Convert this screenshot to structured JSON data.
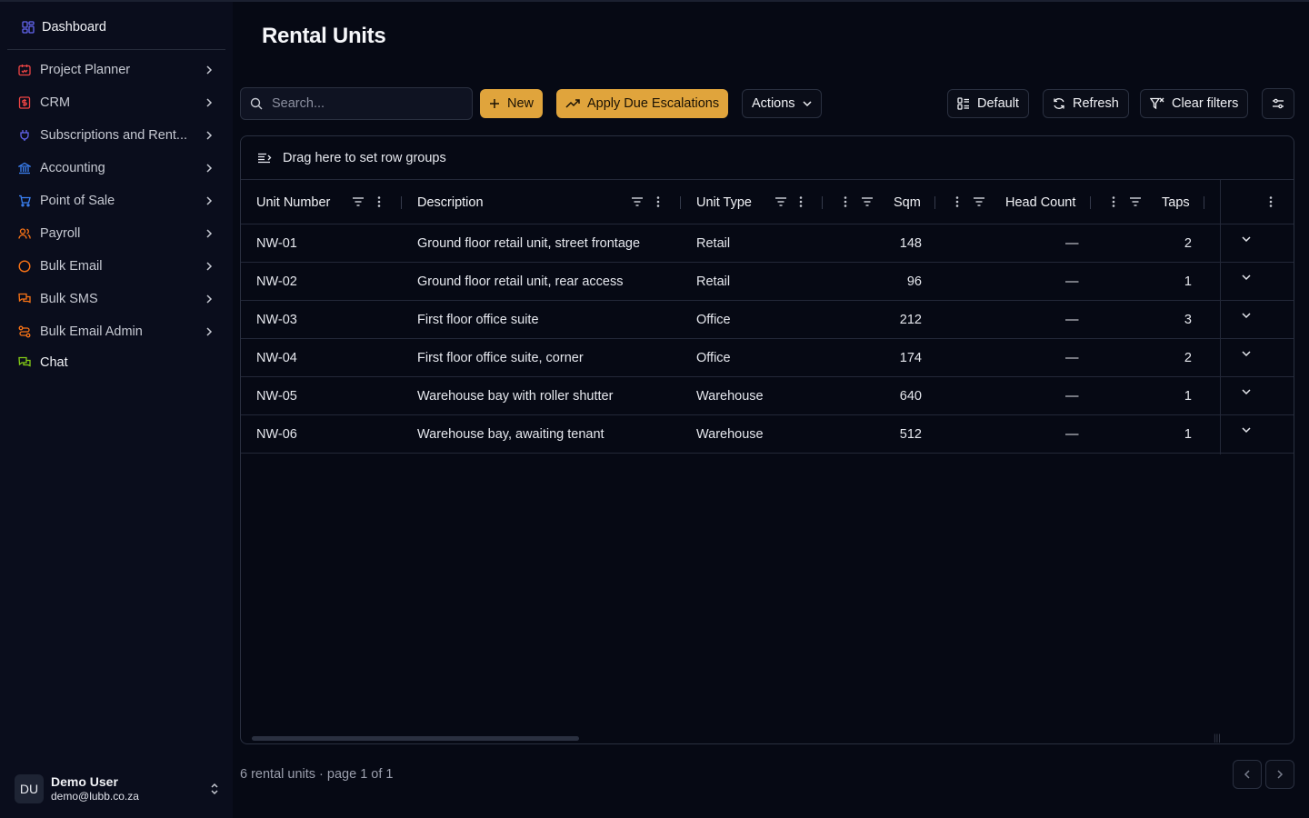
{
  "sidebar": {
    "dashboard": "Dashboard",
    "items": [
      {
        "label": "Project Planner",
        "icon": "calendar-icon",
        "color": "#ef4444"
      },
      {
        "label": "CRM",
        "icon": "dollar-icon",
        "color": "#ef4444"
      },
      {
        "label": "Subscriptions and Rent...",
        "icon": "plug-icon",
        "color": "#6366f1"
      },
      {
        "label": "Accounting",
        "icon": "bank-icon",
        "color": "#3b82f6"
      },
      {
        "label": "Point of Sale",
        "icon": "cart-icon",
        "color": "#3b82f6"
      },
      {
        "label": "Payroll",
        "icon": "users-icon",
        "color": "#f97316"
      },
      {
        "label": "Bulk Email",
        "icon": "circle-icon",
        "color": "#f97316"
      },
      {
        "label": "Bulk SMS",
        "icon": "messages-icon",
        "color": "#f97316"
      },
      {
        "label": "Bulk Email Admin",
        "icon": "route-icon",
        "color": "#f97316"
      },
      {
        "label": "Chat",
        "icon": "chat-icon",
        "color": "#84cc16"
      }
    ],
    "user": {
      "initials": "DU",
      "name": "Demo User",
      "email": "demo@lubb.co.za"
    }
  },
  "page": {
    "title": "Rental Units"
  },
  "toolbar": {
    "search_placeholder": "Search...",
    "new_label": "New",
    "escalation_label": "Apply Due Escalations",
    "actions_label": "Actions",
    "default_label": "Default",
    "refresh_label": "Refresh",
    "clear_filters_label": "Clear filters"
  },
  "grid": {
    "group_hint": "Drag here to set row groups",
    "columns": [
      "Unit Number",
      "Description",
      "Unit Type",
      "Sqm",
      "Head Count",
      "Taps"
    ],
    "rows": [
      [
        "NW-01",
        "Ground floor retail unit, street frontage",
        "Retail",
        "148",
        "—",
        "2"
      ],
      [
        "NW-02",
        "Ground floor retail unit, rear access",
        "Retail",
        "96",
        "—",
        "1"
      ],
      [
        "NW-03",
        "First floor office suite",
        "Office",
        "212",
        "—",
        "3"
      ],
      [
        "NW-04",
        "First floor office suite, corner",
        "Office",
        "174",
        "—",
        "2"
      ],
      [
        "NW-05",
        "Warehouse bay with roller shutter",
        "Warehouse",
        "640",
        "—",
        "1"
      ],
      [
        "NW-06",
        "Warehouse bay, awaiting tenant",
        "Warehouse",
        "512",
        "—",
        "1"
      ]
    ]
  },
  "footer": {
    "summary": "6 rental units · page 1 of 1"
  },
  "colors": {
    "accent": "#e0a43c",
    "background": "#060914",
    "sidebar": "#0a0d1c"
  }
}
